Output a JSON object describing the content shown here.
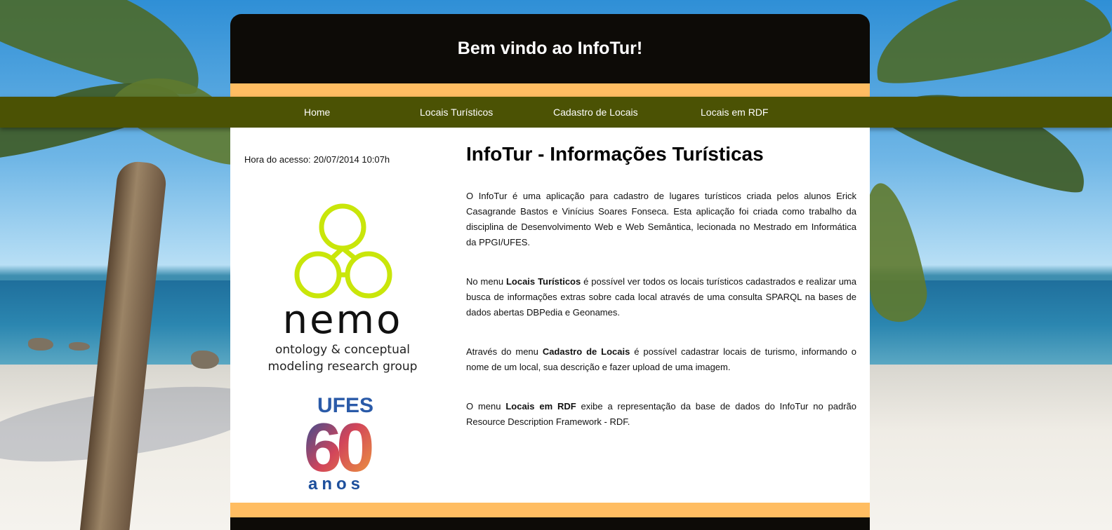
{
  "header": {
    "title": "Bem vindo ao InfoTur!"
  },
  "nav": {
    "items": [
      {
        "label": "Home"
      },
      {
        "label": "Locais Turísticos"
      },
      {
        "label": "Cadastro de Locais"
      },
      {
        "label": "Locais em RDF"
      }
    ]
  },
  "sidebar": {
    "access_label": "Hora do acesso:",
    "access_value": "20/07/2014 10:07h",
    "nemo_logo": {
      "name": "nemo",
      "tagline_1": "ontology & conceptual",
      "tagline_2": "modeling research group",
      "color": "#c9e60a"
    },
    "ufes_logo": {
      "top": "UFES",
      "number": "60",
      "bottom": "anos"
    }
  },
  "main": {
    "title": "InfoTur - Informações Turísticas",
    "p1": "O InfoTur é uma aplicação para cadastro de lugares turísticos criada pelos alunos Erick Casagrande Bastos e Vinícius Soares Fonseca. Esta aplicação foi criada como trabalho da disciplina de Desenvolvimento Web e Web Semântica, lecionada no Mestrado em Informática da PPGI/UFES.",
    "p2_pre": "No menu ",
    "p2_bold": "Locais Turísticos",
    "p2_post": " é possível ver todos os locais turísticos cadastrados e realizar uma busca de informações extras sobre cada local através de uma consulta SPARQL na bases de dados abertas DBPedia e Geonames.",
    "p3_pre": "Através do menu ",
    "p3_bold": "Cadastro de Locais",
    "p3_post": " é possível cadastrar locais de turismo, informando o nome de um local, sua descrição e fazer upload de uma imagem.",
    "p4_pre": "O menu ",
    "p4_bold": "Locais em RDF",
    "p4_post": " exibe a representação da base de dados do InfoTur no padrão Resource Description Framework - RDF."
  },
  "colors": {
    "header_bg": "#0d0b07",
    "accent_orange": "#ffbd62",
    "nav_bg": "#4b5204"
  }
}
